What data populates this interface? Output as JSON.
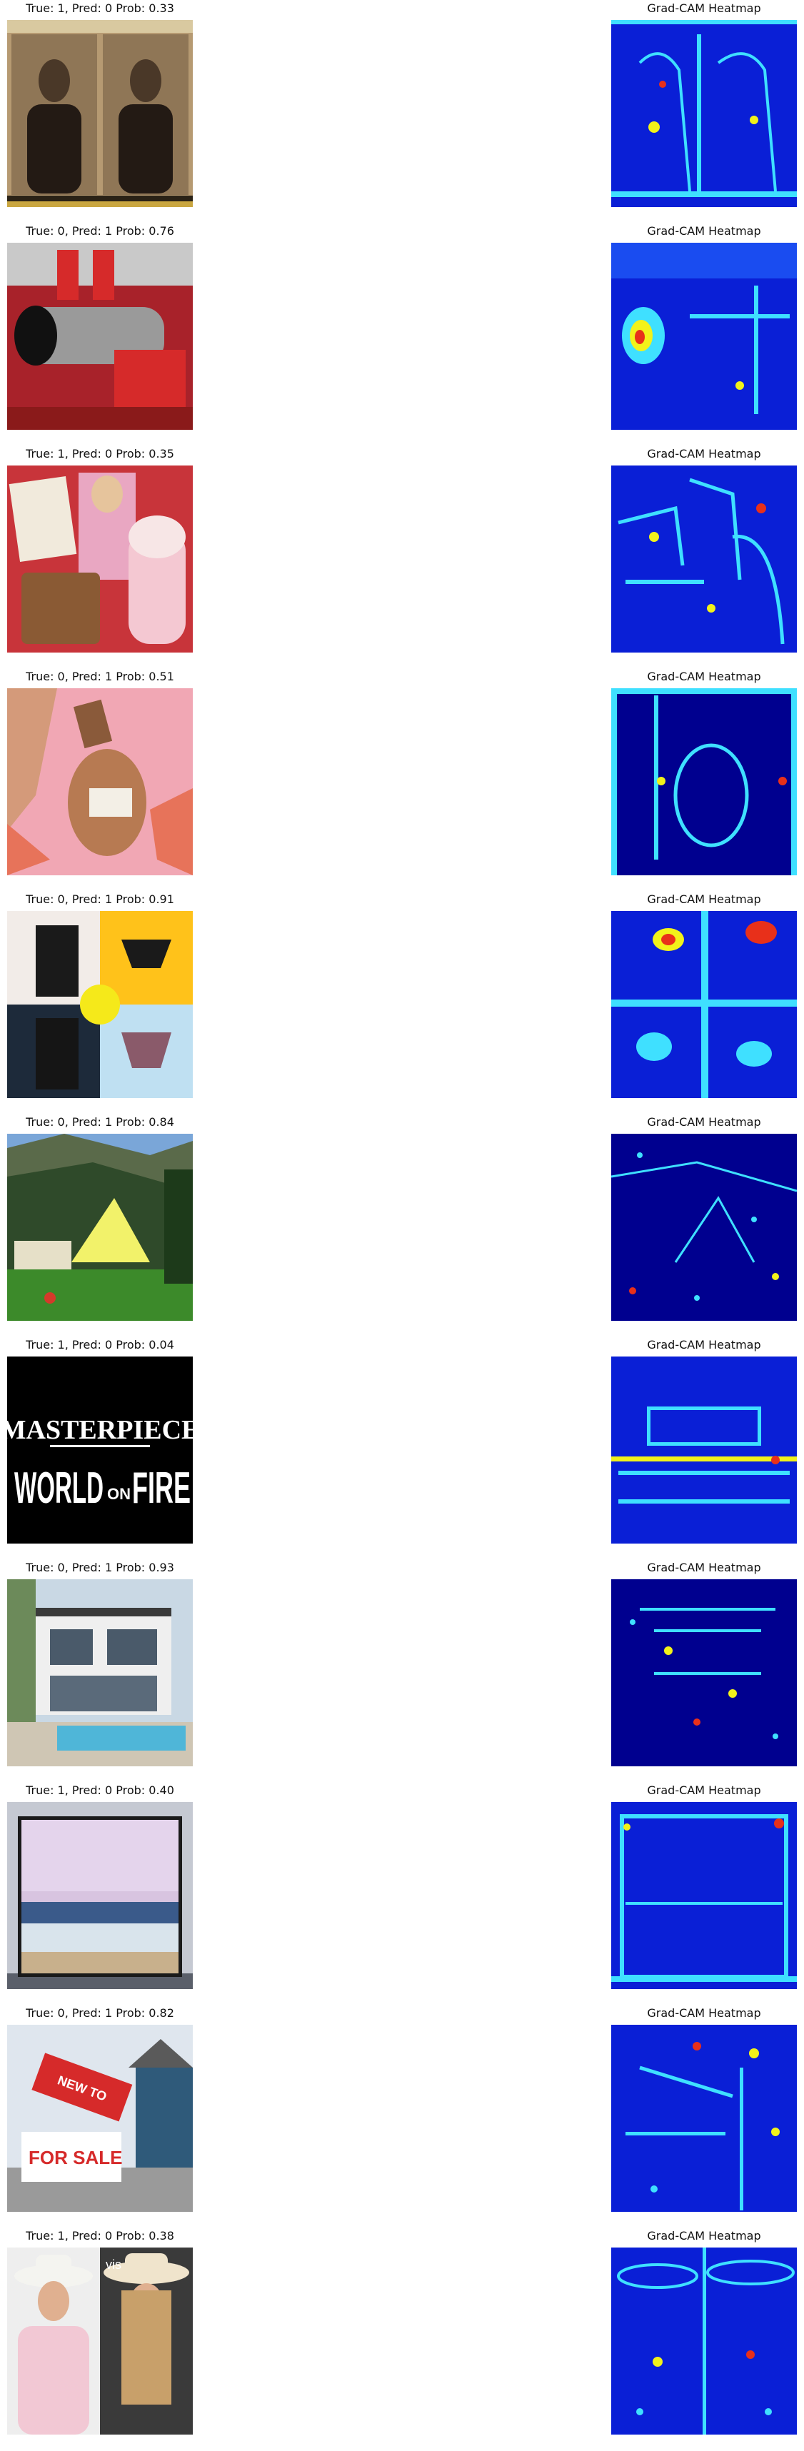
{
  "heatmap_title": "Grad-CAM Heatmap",
  "rows": [
    {
      "caption": "True: 1, Pred: 0 Prob: 0.33",
      "image": "lincoln-portrait-photo",
      "heatmap": "gradcam-heatmap-lincoln"
    },
    {
      "caption": "True: 0, Pred: 1 Prob: 0.76",
      "image": "red-industrial-machine",
      "heatmap": "gradcam-heatmap-machine"
    },
    {
      "caption": "True: 1, Pred: 0 Prob: 0.35",
      "image": "gift-collage-photo",
      "heatmap": "gradcam-heatmap-collage"
    },
    {
      "caption": "True: 0, Pred: 1 Prob: 0.51",
      "image": "cosmetic-bottle-pink",
      "heatmap": "gradcam-heatmap-bottle"
    },
    {
      "caption": "True: 0, Pred: 1 Prob: 0.91",
      "image": "shapewear-product-grid",
      "heatmap": "gradcam-heatmap-shapewear"
    },
    {
      "caption": "True: 0, Pred: 1 Prob: 0.84",
      "image": "mountain-hotel-photo",
      "heatmap": "gradcam-heatmap-hotel"
    },
    {
      "caption": "True: 1, Pred: 0 Prob: 0.04",
      "image": "masterpiece-world-on-fire-poster",
      "heatmap": "gradcam-heatmap-poster",
      "poster_line1": "MASTERPIECE",
      "poster_line2": "WORLD",
      "poster_small": "ON",
      "poster_line3": "FIRE"
    },
    {
      "caption": "True: 0, Pred: 1 Prob: 0.93",
      "image": "modern-house-pool",
      "heatmap": "gradcam-heatmap-house"
    },
    {
      "caption": "True: 1, Pred: 0 Prob: 0.40",
      "image": "tv-screen-seascape",
      "heatmap": "gradcam-heatmap-tv"
    },
    {
      "caption": "True: 0, Pred: 1 Prob: 0.82",
      "image": "for-sale-sign-house",
      "heatmap": "gradcam-heatmap-sale",
      "sign_top": "NEW TO",
      "sign_bottom": "FOR SALE"
    },
    {
      "caption": "True: 1, Pred: 0 Prob: 0.38",
      "image": "cowboy-hat-portraits",
      "heatmap": "gradcam-heatmap-cowboy",
      "side_text": "vis"
    }
  ],
  "colors": {
    "heatmap_base": "#0a1fd6",
    "heatmap_dark": "#00008f",
    "heatmap_cyan": "#3fe0ff",
    "heatmap_yellow": "#f2f21a",
    "heatmap_red": "#e8301a"
  }
}
